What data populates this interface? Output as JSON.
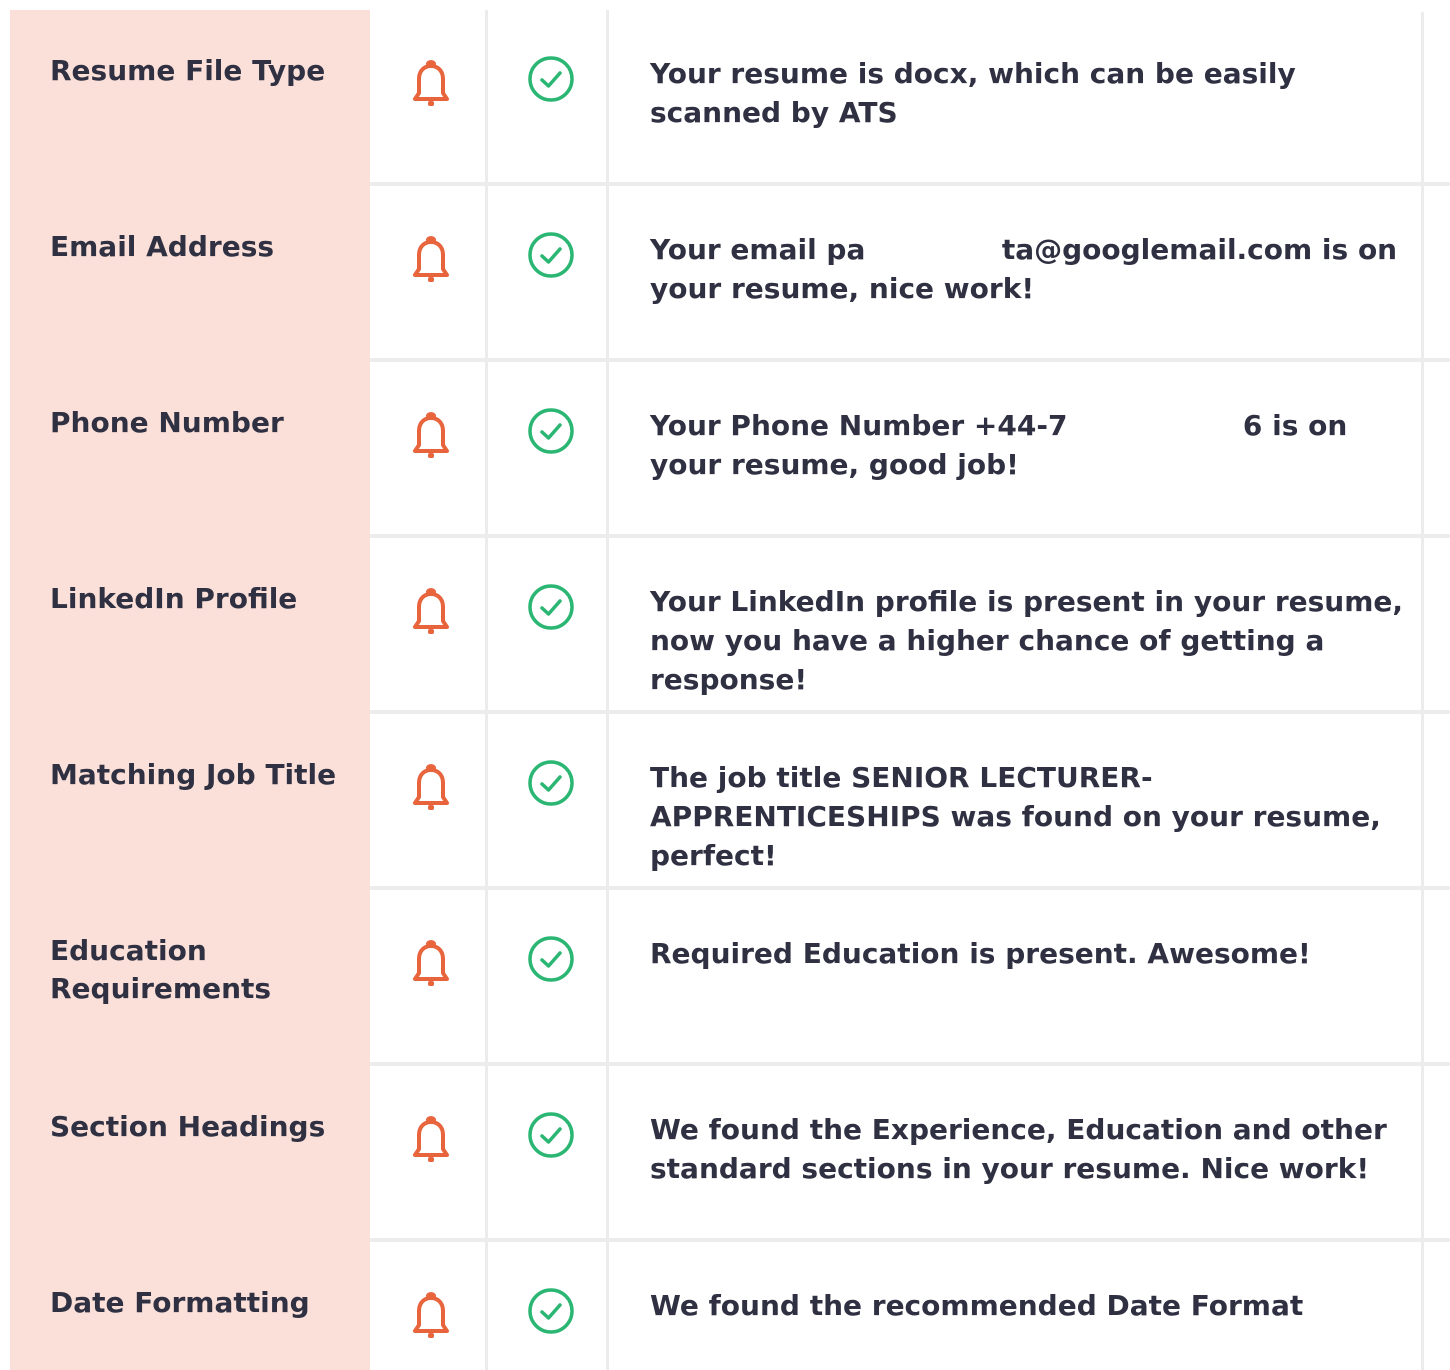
{
  "colors": {
    "label_bg": "#fbe0d9",
    "bell": "#e8643c",
    "check": "#2bb673",
    "text": "#2f3142",
    "divider": "#ececec"
  },
  "icons": {
    "status": "bell-icon",
    "result": "check-circle-icon"
  },
  "checks": [
    {
      "label": "Resume File Type",
      "message": "Your resume is docx, which can be easily scanned by ATS"
    },
    {
      "label": "Email Address",
      "message": "Your email pa              ta@googlemail.com is on your resume, nice work!"
    },
    {
      "label": "Phone Number",
      "message": "Your Phone Number +44-7                  6 is on your resume, good job!"
    },
    {
      "label": "LinkedIn Profile",
      "message": "Your LinkedIn profile is present in your resume, now you have a higher chance of getting a response!"
    },
    {
      "label": "Matching Job Title",
      "message": "The job title SENIOR LECTURER-APPRENTICESHIPS was found on your resume, perfect!"
    },
    {
      "label": "Education Requirements",
      "message": "Required Education is present. Awesome!"
    },
    {
      "label": "Section Headings",
      "message": "We found the Experience, Education and other standard sections in your resume. Nice work!"
    },
    {
      "label": "Date Formatting",
      "message": "We found the recommended Date Format"
    }
  ]
}
